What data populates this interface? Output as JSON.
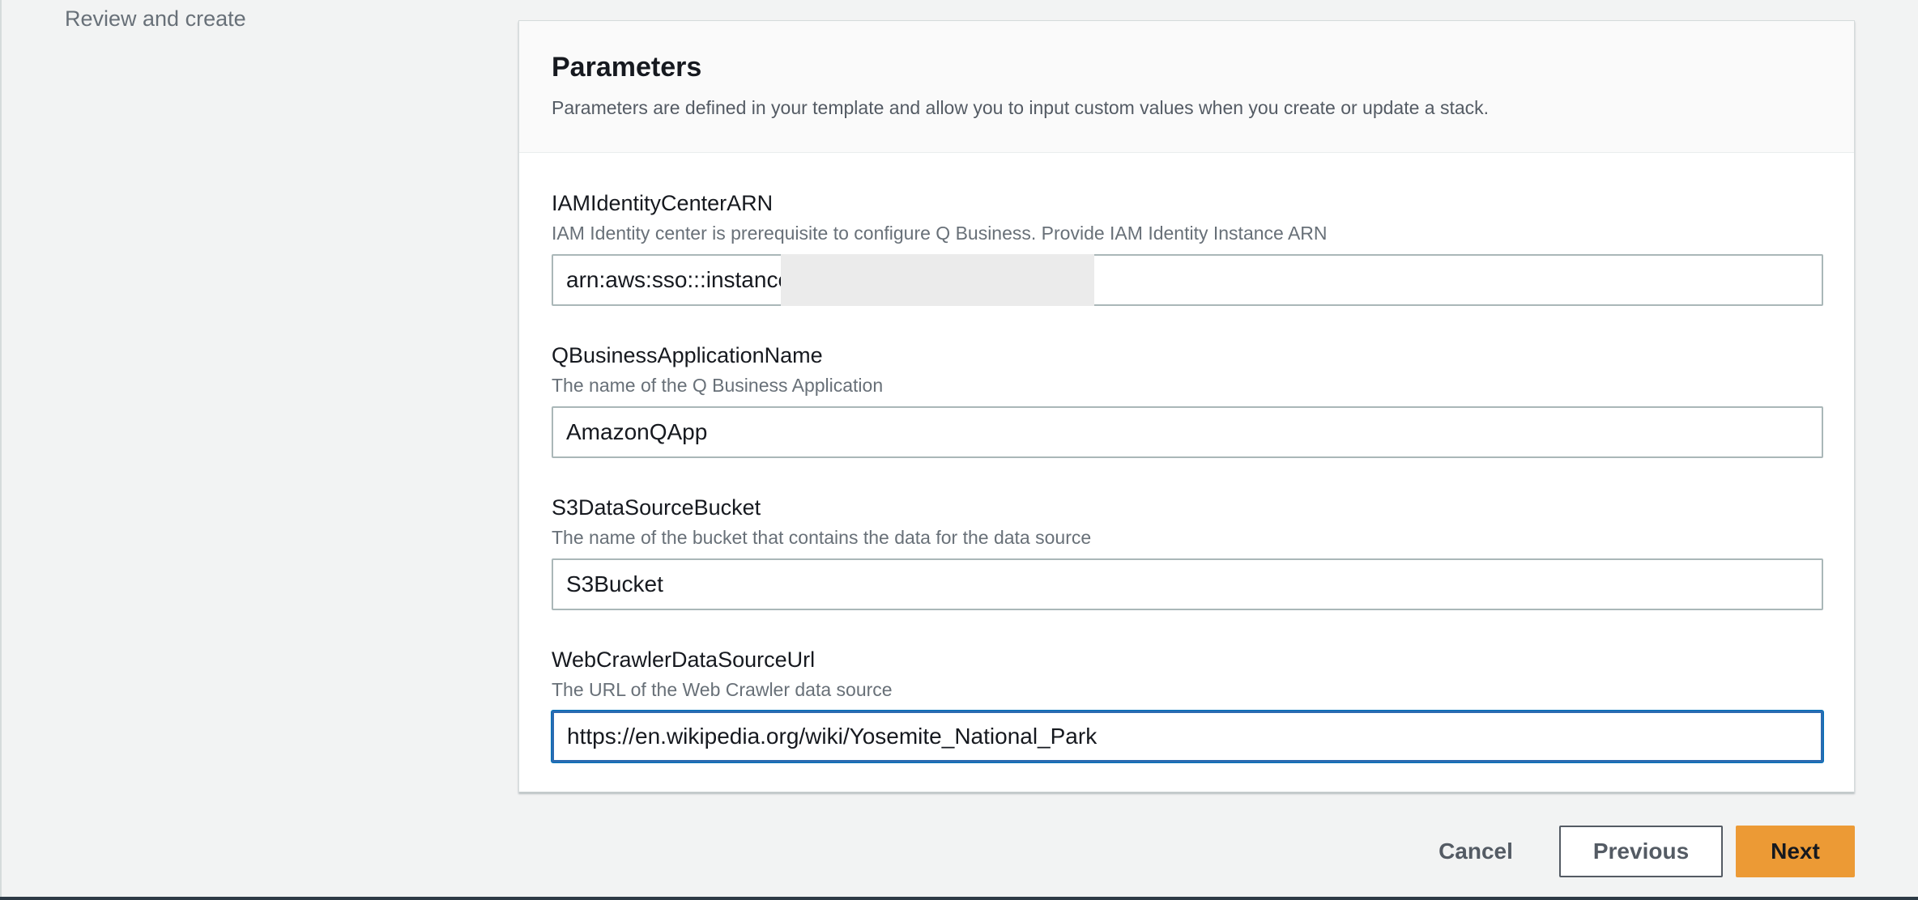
{
  "left_nav": {
    "review_label": "Review and create"
  },
  "parameters": {
    "title": "Parameters",
    "description": "Parameters are defined in your template and allow you to input custom values when you create or update a stack.",
    "fields": [
      {
        "label": "IAMIdentityCenterARN",
        "description": "IAM Identity center is prerequisite to configure Q Business. Provide IAM Identity Instance ARN",
        "value": "arn:aws:sso:::instance"
      },
      {
        "label": "QBusinessApplicationName",
        "description": "The name of the Q Business Application",
        "value": "AmazonQApp"
      },
      {
        "label": "S3DataSourceBucket",
        "description": "The name of the bucket that contains the data for the data source",
        "value": "S3Bucket"
      },
      {
        "label": "WebCrawlerDataSourceUrl",
        "description": "The URL of the Web Crawler data source",
        "value": "https://en.wikipedia.org/wiki/Yosemite_National_Park"
      }
    ]
  },
  "footer": {
    "cancel_label": "Cancel",
    "previous_label": "Previous",
    "next_label": "Next"
  },
  "colors": {
    "primary_button": "#ec9a35",
    "focus_border": "#2b6bb1",
    "background": "#f2f3f3"
  }
}
